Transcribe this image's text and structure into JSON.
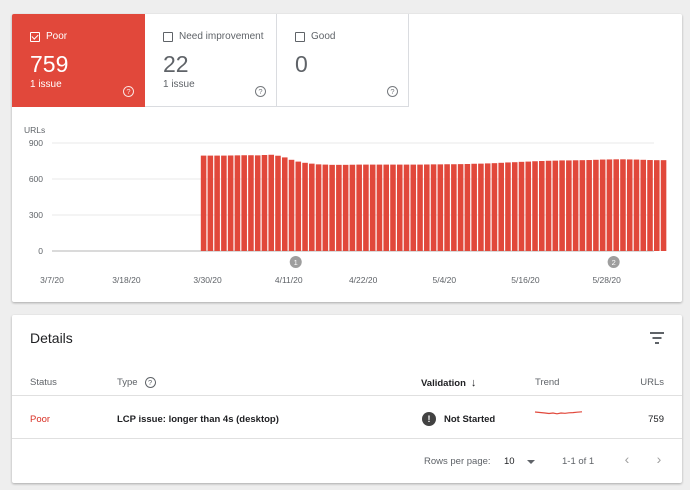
{
  "tiles": [
    {
      "label": "Poor",
      "count": "759",
      "sub": "1 issue",
      "checked": true
    },
    {
      "label": "Need improvement",
      "count": "22",
      "sub": "1 issue",
      "checked": false
    },
    {
      "label": "Good",
      "count": "0",
      "sub": "",
      "checked": false
    }
  ],
  "help_glyph": "?",
  "chart_data": {
    "type": "bar",
    "ylabel": "URLs",
    "ylim": [
      0,
      900
    ],
    "yticks": [
      0,
      300,
      600,
      900
    ],
    "ytick_labels": [
      "0",
      "300",
      "600",
      "900"
    ],
    "xtick_labels": [
      "3/7/20",
      "3/18/20",
      "3/30/20",
      "4/11/20",
      "4/22/20",
      "5/4/20",
      "5/16/20",
      "5/28/20"
    ],
    "bar_color": "#e1483b",
    "grid": true,
    "annotations": [
      {
        "label": "1",
        "near": "4/11/20"
      },
      {
        "label": "2",
        "near": "5/28/20"
      }
    ],
    "x_range": [
      "3/7/20",
      "6/4/20"
    ],
    "bars_start": "3/29/20",
    "values": [
      795,
      795,
      795,
      795,
      796,
      797,
      798,
      798,
      797,
      800,
      802,
      794,
      780,
      760,
      745,
      735,
      728,
      722,
      720,
      718,
      718,
      718,
      719,
      720,
      720,
      720,
      720,
      720,
      720,
      720,
      720,
      720,
      720,
      721,
      722,
      722,
      723,
      723,
      724,
      725,
      727,
      728,
      730,
      732,
      735,
      738,
      740,
      743,
      745,
      748,
      750,
      752,
      753,
      755,
      755,
      756,
      757,
      758,
      760,
      762,
      763,
      764,
      764,
      763,
      762,
      760,
      758,
      757,
      757
    ]
  },
  "details": {
    "title": "Details",
    "columns": {
      "status": "Status",
      "type": "Type",
      "validation": "Validation",
      "trend": "Trend",
      "urls": "URLs"
    },
    "sort_glyph": "↓",
    "rows": [
      {
        "status": "Poor",
        "type": "LCP issue: longer than 4s (desktop)",
        "validation_icon": "!",
        "validation": "Not Started",
        "urls": "759"
      }
    ],
    "footer": {
      "rows_per_page_label": "Rows per page:",
      "rows_per_page_value": "10",
      "range": "1-1 of 1",
      "prev_glyph": "‹",
      "next_glyph": "›"
    }
  },
  "colors": {
    "poor": "#e1483b",
    "status_poor_text": "#d93025",
    "trend_line": "#e1483b"
  }
}
